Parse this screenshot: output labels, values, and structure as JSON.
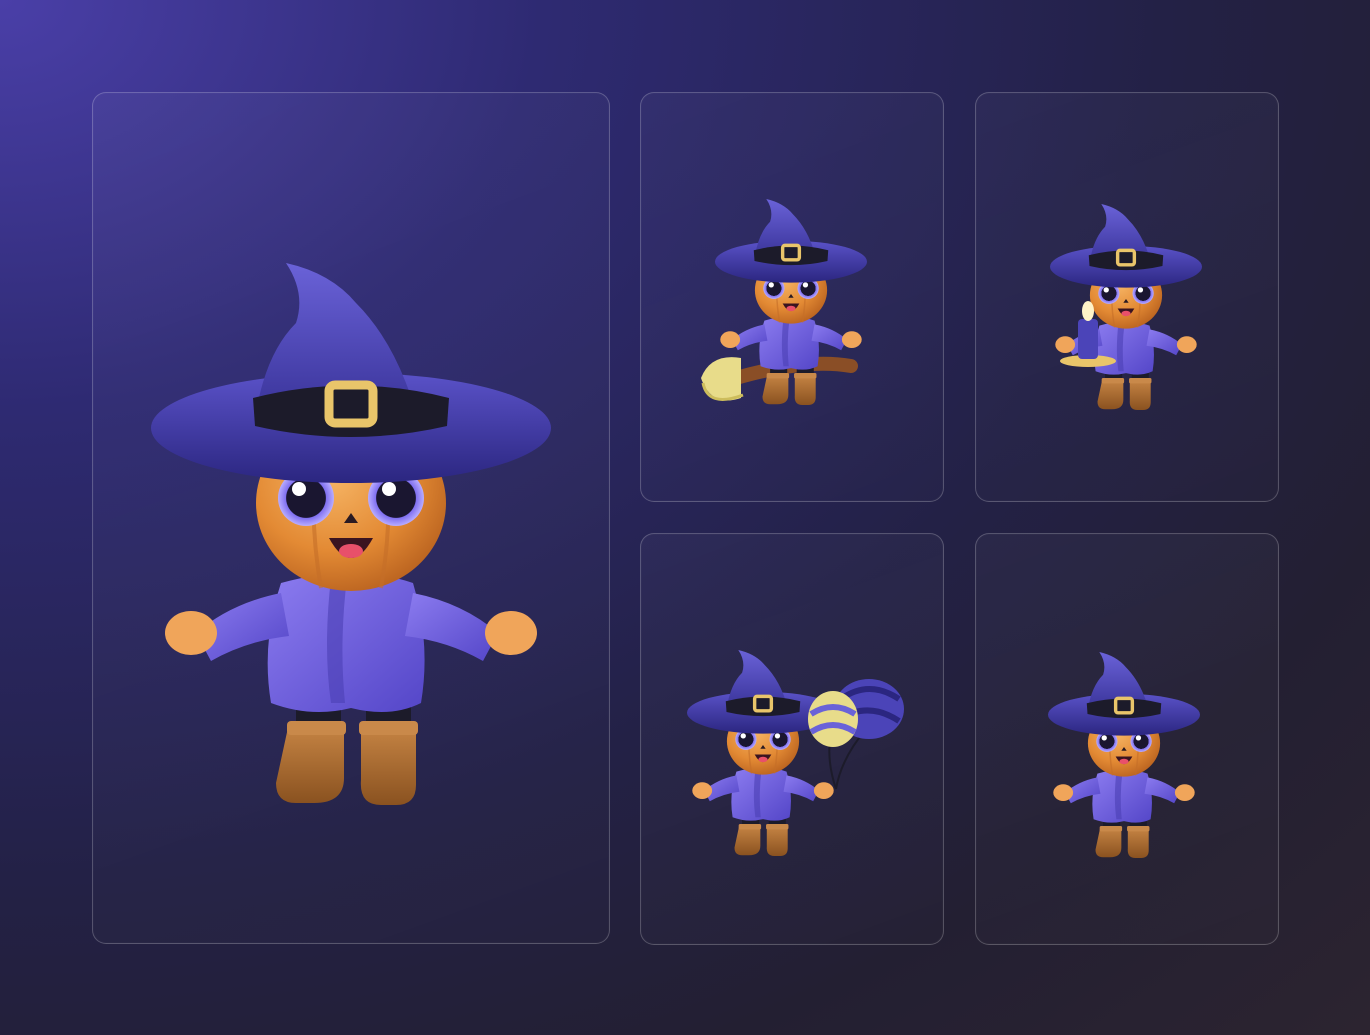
{
  "colors": {
    "background_top": "#4a3fa8",
    "background_bottom": "#231f32",
    "hat": "#4b44b8",
    "hat_band": "#1c1b2a",
    "buckle": "#e9c56a",
    "pumpkin": "#e8923a",
    "robe": "#6a5ae0",
    "boots": "#a8692e",
    "broom_straw": "#e8dc8a"
  },
  "cards": [
    {
      "pose": "jumping-arms-up",
      "icon": "pumpkin-witch-character"
    },
    {
      "pose": "riding-broom",
      "icon": "pumpkin-witch-on-broom"
    },
    {
      "pose": "holding-candle",
      "icon": "pumpkin-witch-with-candle"
    },
    {
      "pose": "holding-balloons",
      "icon": "pumpkin-witch-with-balloons"
    },
    {
      "pose": "waving",
      "icon": "pumpkin-witch-waving"
    }
  ]
}
